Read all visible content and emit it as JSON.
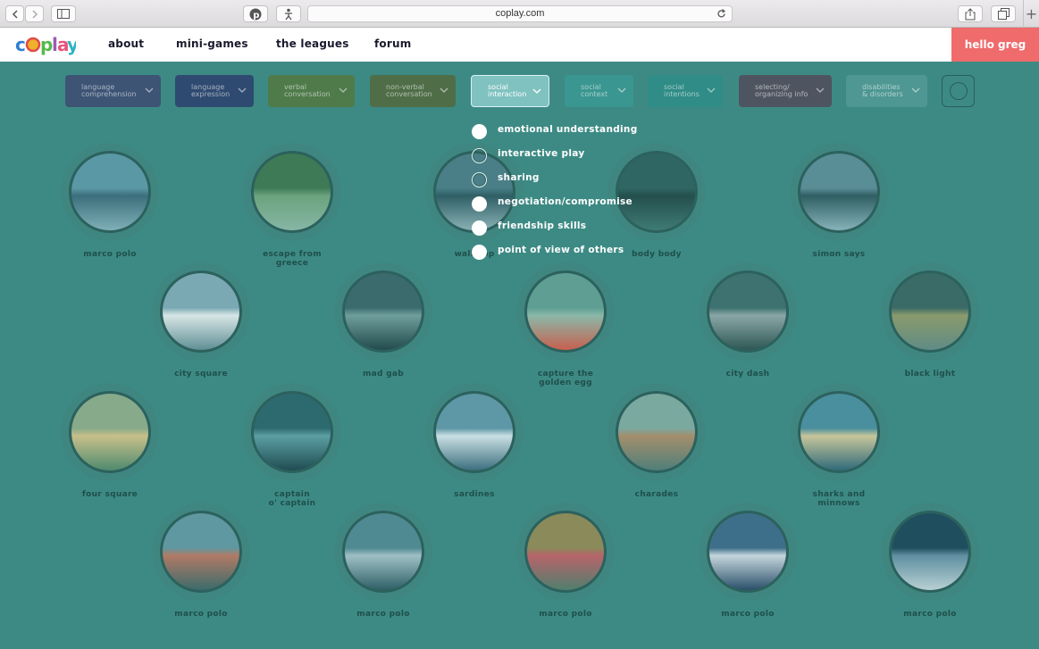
{
  "browser": {
    "url": "coplay.com"
  },
  "site": {
    "logo_text": "coplay",
    "nav": [
      "about",
      "mini-games",
      "the leagues",
      "forum"
    ],
    "user_greeting": "hello greg"
  },
  "filters": [
    {
      "label_line1": "language",
      "label_line2": "comprehension",
      "color": "#3d5475"
    },
    {
      "label_line1": "language",
      "label_line2": "expression",
      "color": "#2f4a70"
    },
    {
      "label_line1": "verbal",
      "label_line2": "conversation",
      "color": "#4f7a4a"
    },
    {
      "label_line1": "non-verbal",
      "label_line2": "conversation",
      "color": "#4f6e47"
    },
    {
      "label_line1": "social",
      "label_line2": "interaction",
      "color": "#7fc2c0"
    },
    {
      "label_line1": "social",
      "label_line2": "context",
      "color": "#3a9690"
    },
    {
      "label_line1": "social",
      "label_line2": "intentions",
      "color": "#2f8c86"
    },
    {
      "label_line1": "selecting/",
      "label_line2": "organizing info",
      "color": "#4e5560"
    },
    {
      "label_line1": "disabilities",
      "label_line2": "& disorders",
      "color": "#4e9792"
    }
  ],
  "dropdown": {
    "options": [
      {
        "label": "emotional understanding",
        "selected": true
      },
      {
        "label": "interactive play",
        "selected": false
      },
      {
        "label": "sharing",
        "selected": false
      },
      {
        "label": "negotiation/compromise",
        "selected": true
      },
      {
        "label": "friendship skills",
        "selected": true
      },
      {
        "label": "point of view of others",
        "selected": true
      }
    ]
  },
  "games": [
    {
      "line1": "marco polo",
      "line2": ""
    },
    {
      "line1": "escape from",
      "line2": "greece"
    },
    {
      "line1": "wall hop",
      "line2": ""
    },
    {
      "line1": "body body",
      "line2": ""
    },
    {
      "line1": "simon says",
      "line2": ""
    },
    {
      "line1": "city square",
      "line2": ""
    },
    {
      "line1": "mad gab",
      "line2": ""
    },
    {
      "line1": "capture the",
      "line2": "golden egg"
    },
    {
      "line1": "city dash",
      "line2": ""
    },
    {
      "line1": "black light",
      "line2": ""
    },
    {
      "line1": "four square",
      "line2": ""
    },
    {
      "line1": "captain",
      "line2": "o' captain"
    },
    {
      "line1": "sardines",
      "line2": ""
    },
    {
      "line1": "charades",
      "line2": ""
    },
    {
      "line1": "sharks and",
      "line2": "minnows"
    },
    {
      "line1": "marco polo",
      "line2": ""
    },
    {
      "line1": "marco polo",
      "line2": ""
    },
    {
      "line1": "marco polo",
      "line2": ""
    },
    {
      "line1": "marco polo",
      "line2": ""
    },
    {
      "line1": "marco polo",
      "line2": ""
    }
  ]
}
